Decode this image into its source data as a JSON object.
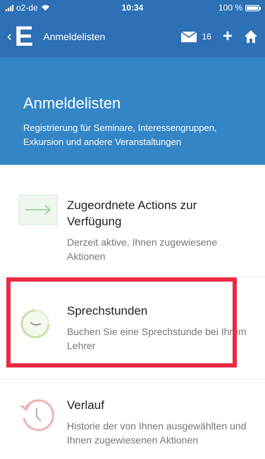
{
  "status_bar": {
    "carrier": "o2-de",
    "time": "10:34",
    "battery": "100 %",
    "battery_level": 1.0
  },
  "nav": {
    "logo": "E",
    "title": "Anmeldelisten",
    "mail_count": "16",
    "back_icon": "chevron-left-icon",
    "mail_icon": "envelope-icon",
    "add_icon": "plus-icon",
    "home_icon": "home-icon"
  },
  "banner": {
    "title": "Anmeldelisten",
    "subtitle": "Registrierung für Seminare, Interessengruppen, Exkursion und andere Veranstaltungen"
  },
  "menu": [
    {
      "title": "Zugeordnete Actions zur Verfügung",
      "description": "Derzeit aktive, Ihnen zugewiesene Aktionen",
      "icon": "arrow-right-icon"
    },
    {
      "title": "Sprechstunden",
      "description": "Buchen Sie eine Sprechstunde bei Ihrem Lehrer",
      "icon": "clock-icon"
    },
    {
      "title": "Verlauf",
      "description": "Historie der von Ihnen ausgewählten und Ihnen zugewiesenen Aktionen",
      "icon": "history-icon"
    }
  ],
  "colors": {
    "nav_bg": "#2d70b6",
    "banner_bg": "#3385c6",
    "highlight": "#ea2a44",
    "arrow_icon": "#a9d4a9",
    "clock_icon": "#c8e0a8",
    "history_icon": "#f0b2b2"
  }
}
